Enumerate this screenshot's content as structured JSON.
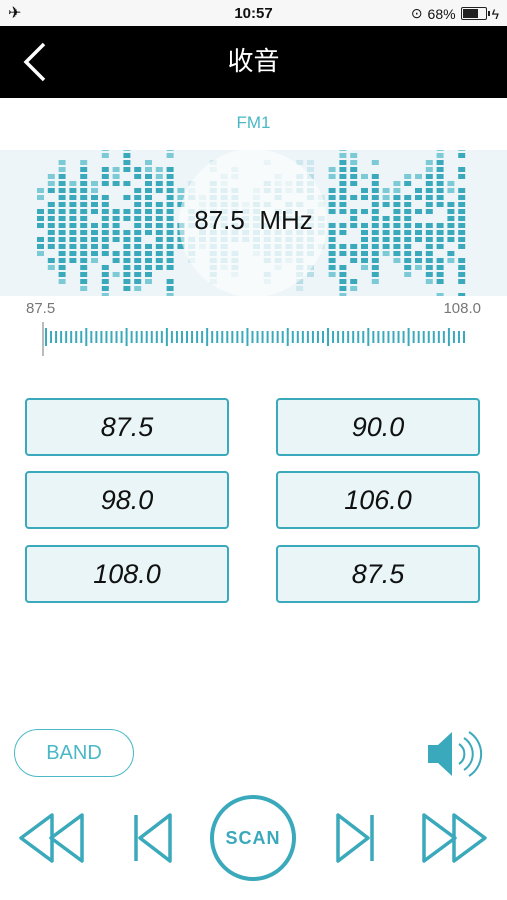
{
  "status_bar": {
    "time": "10:57",
    "battery": "68%",
    "battery_level": 0.68
  },
  "header": {
    "title": "收音"
  },
  "radio": {
    "band": "FM1",
    "frequency": "87.5",
    "unit": "MHz",
    "range_min": "87.5",
    "range_max": "108.0",
    "tuner_position": 0
  },
  "presets": [
    "87.5",
    "90.0",
    "98.0",
    "106.0",
    "108.0",
    "87.5"
  ],
  "controls": {
    "band_label": "BAND",
    "scan_label": "SCAN"
  },
  "colors": {
    "accent": "#3aa9bb",
    "nav_bg": "#000000",
    "preset_bg": "#e9f5f6",
    "viz_bg": "#eef5f8"
  },
  "icons": [
    "airplane-icon",
    "back-chevron-icon",
    "orientation-lock-icon",
    "battery-icon",
    "charging-icon",
    "speaker-icon",
    "fast-rewind-icon",
    "previous-icon",
    "next-icon",
    "fast-forward-icon"
  ]
}
